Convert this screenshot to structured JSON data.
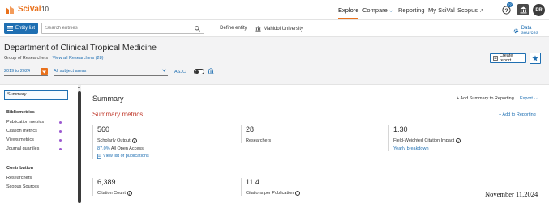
{
  "app": {
    "logo": "SciVal",
    "version": "10"
  },
  "nav": {
    "explore": "Explore",
    "compare": "Compare",
    "reporting": "Reporting",
    "my_scival": "My SciVal",
    "scopus": "Scopus",
    "help_badge": "??",
    "avatar_initials": "PR"
  },
  "entity_bar": {
    "entity_list_label": "Entity list",
    "search_placeholder": "Search entities",
    "define_entity": "+ Define entity",
    "institution": "Mahidol University",
    "data_sources": "Data sources"
  },
  "header": {
    "title": "Department of Clinical Tropical Medicine",
    "group_label": "Group of Researchers",
    "view_all": "View all Researchers (28)",
    "create_report": "Create report",
    "year_range": "2019 to 2024",
    "subject_areas": "All subject areas",
    "asjc": "ASJC"
  },
  "sidebar": {
    "summary": "Summary",
    "groups": [
      {
        "title": "Bibliometrics",
        "items": [
          "Publication metrics",
          "Citation metrics",
          "Views metrics",
          "Journal quartiles"
        ]
      },
      {
        "title": "Contribution",
        "items": [
          "Researchers",
          "Scopus Sources"
        ]
      }
    ]
  },
  "main": {
    "title": "Summary",
    "add_summary": "+ Add Summary to Reporting",
    "export": "Export",
    "section_title": "Summary metrics",
    "add_reporting": "+ Add to Reporting",
    "metrics": [
      {
        "value": "560",
        "label": "Scholarly Output",
        "sub_pct": "87.0%",
        "sub_text": "All Open Access",
        "link": "View list of publications"
      },
      {
        "value": "28",
        "label": "Researchers"
      },
      {
        "value": "1.30",
        "label": "Field-Weighted Citation Impact",
        "link": "Yearly breakdown"
      },
      {
        "value": "6,389",
        "label": "Citation Count"
      },
      {
        "value": "11.4",
        "label": "Citations per Publication"
      }
    ]
  },
  "date_stamp": "November 11,2024",
  "colors": {
    "accent": "#e9711c",
    "link": "#1f6fb2",
    "section": "#c0392b",
    "dot": "#9b59d0"
  }
}
